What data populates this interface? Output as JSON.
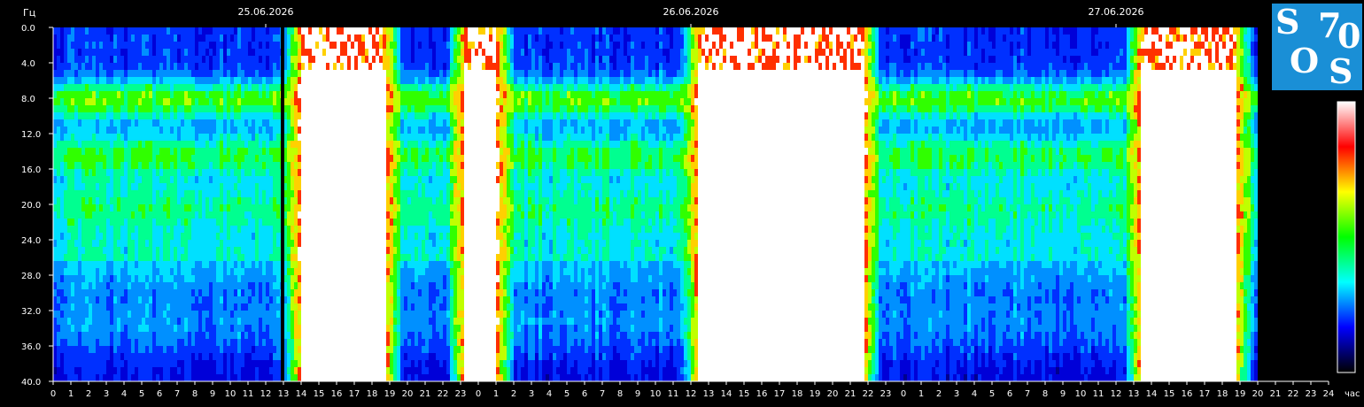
{
  "chart_data": {
    "type": "heatmap",
    "y_unit_label": "Гц",
    "x_unit_label": "час",
    "ylim": [
      0,
      40
    ],
    "y_ticks": [
      "0.0",
      "4.0",
      "8.0",
      "12.0",
      "16.0",
      "20.0",
      "24.0",
      "28.0",
      "32.0",
      "36.0",
      "40.0"
    ],
    "x_ticks": [
      "0",
      "1",
      "2",
      "3",
      "4",
      "5",
      "6",
      "7",
      "8",
      "9",
      "10",
      "11",
      "12",
      "13",
      "14",
      "15",
      "16",
      "17",
      "18",
      "19",
      "20",
      "21",
      "22",
      "23",
      "0",
      "1",
      "2",
      "3",
      "4",
      "5",
      "6",
      "7",
      "8",
      "9",
      "10",
      "11",
      "12",
      "13",
      "14",
      "15",
      "16",
      "17",
      "18",
      "19",
      "20",
      "21",
      "22",
      "23",
      "0",
      "1",
      "2",
      "3",
      "4",
      "5",
      "6",
      "7",
      "8",
      "9",
      "10",
      "11",
      "12",
      "13",
      "14",
      "15",
      "16",
      "17",
      "18",
      "19",
      "20",
      "21",
      "22",
      "23",
      "24"
    ],
    "dates": [
      "25.06.2026",
      "26.06.2026",
      "27.06.2026"
    ],
    "x_range_hours": [
      0,
      72
    ],
    "data_end_hour": 68,
    "resonance_bands_hz": [
      7.8,
      14.1,
      20.0,
      26.0,
      33.0
    ],
    "saturated_periods_hours": [
      [
        14,
        18.5
      ],
      [
        23.3,
        24.8
      ],
      [
        36.5,
        45.5
      ],
      [
        61.5,
        66.5
      ]
    ],
    "gap_hour": 12.95,
    "colorbar": [
      "#000000",
      "#0000ff",
      "#00ffff",
      "#00ff00",
      "#ffff00",
      "#ff0000",
      "#ffffff"
    ],
    "grid": false
  },
  "logo": {
    "letters": [
      "S",
      "O",
      "S",
      "7",
      "0"
    ],
    "bg": "#1a8fd6"
  }
}
